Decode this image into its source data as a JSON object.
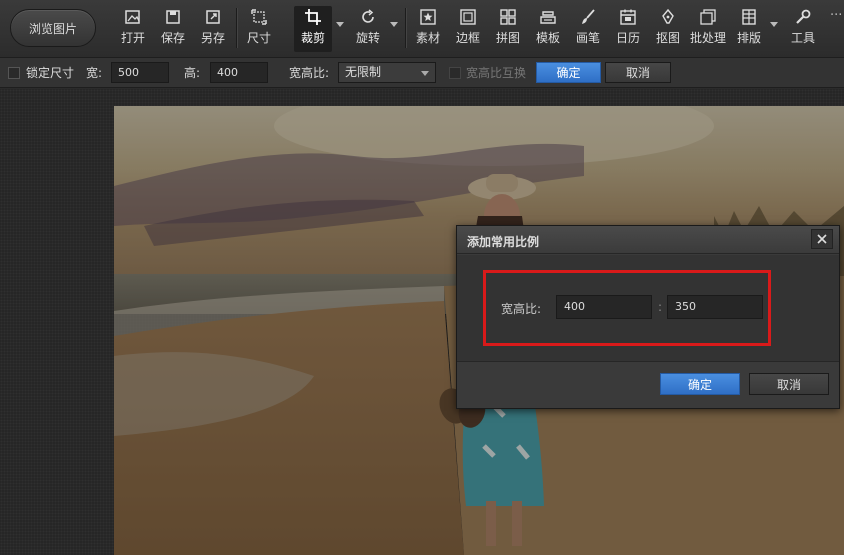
{
  "toolbar": {
    "browse_label": "浏览图片",
    "tools": [
      {
        "id": "open",
        "label": "打开",
        "icon": "open-image-icon"
      },
      {
        "id": "save",
        "label": "保存",
        "icon": "save-icon"
      },
      {
        "id": "saveas",
        "label": "另存",
        "icon": "save-as-icon"
      },
      {
        "id": "size",
        "label": "尺寸",
        "icon": "resize-icon"
      },
      {
        "id": "crop",
        "label": "裁剪",
        "icon": "crop-icon"
      },
      {
        "id": "rotate",
        "label": "旋转",
        "icon": "rotate-icon"
      },
      {
        "id": "material",
        "label": "素材",
        "icon": "star-icon"
      },
      {
        "id": "border",
        "label": "边框",
        "icon": "frame-icon"
      },
      {
        "id": "collage",
        "label": "拼图",
        "icon": "grid-icon"
      },
      {
        "id": "template",
        "label": "模板",
        "icon": "template-icon"
      },
      {
        "id": "brush",
        "label": "画笔",
        "icon": "brush-icon"
      },
      {
        "id": "calendar",
        "label": "日历",
        "icon": "calendar-icon"
      },
      {
        "id": "cutout",
        "label": "抠图",
        "icon": "pen-icon"
      },
      {
        "id": "batch",
        "label": "批处理",
        "icon": "batch-icon"
      },
      {
        "id": "layout",
        "label": "排版",
        "icon": "layout-icon"
      },
      {
        "id": "tools",
        "label": "工具",
        "icon": "wrench-icon"
      }
    ],
    "more_label": "···"
  },
  "subbar": {
    "lock_size_label": "锁定尺寸",
    "width_label": "宽:",
    "width_value": "500",
    "height_label": "高:",
    "height_value": "400",
    "ratio_label": "宽高比:",
    "ratio_value": "无限制",
    "swap_label": "宽高比互换",
    "ok_label": "确定",
    "cancel_label": "取消"
  },
  "dialog": {
    "title": "添加常用比例",
    "ratio_label": "宽高比:",
    "ratio_w": "400",
    "separator": ":",
    "ratio_h": "350",
    "ok_label": "确定",
    "cancel_label": "取消",
    "highlight_color": "#d91a1a"
  },
  "colors": {
    "primary": "#3a7fd6",
    "toolbar_bg": "#333333"
  }
}
